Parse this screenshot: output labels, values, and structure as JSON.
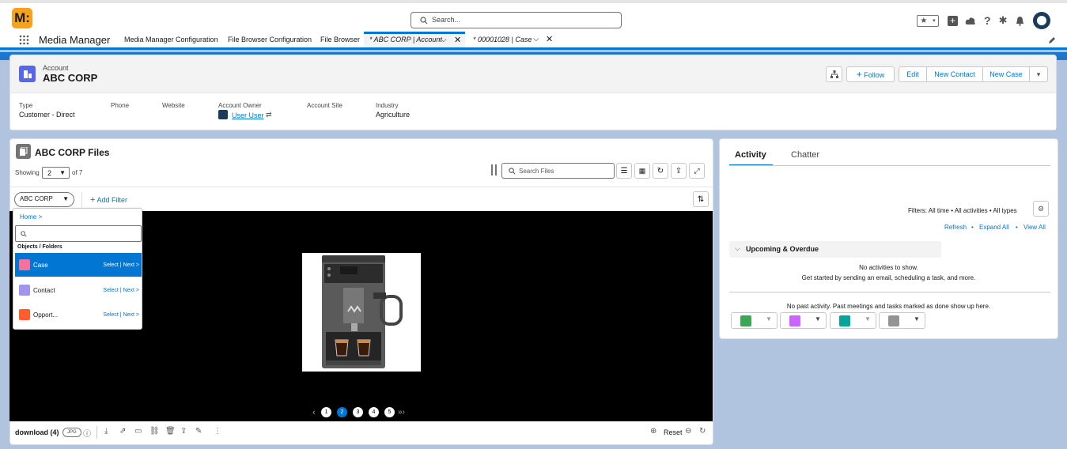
{
  "header": {
    "logo_text": "M:",
    "search_placeholder": "Search...",
    "icons": [
      "favorites-icon",
      "add-icon",
      "cloud-icon",
      "help-icon",
      "settings-icon",
      "bell-icon",
      "avatar"
    ]
  },
  "nav": {
    "app_name": "Media Manager",
    "items": [
      "Media Manager Configuration",
      "File Browser Configuration",
      "File Browser"
    ],
    "tabs": [
      {
        "label": "* ABC CORP | Account",
        "active": true
      },
      {
        "label": "* 00001028 | Case",
        "active": false
      }
    ]
  },
  "account": {
    "object_label": "Account",
    "name": "ABC CORP",
    "buttons": {
      "follow": "Follow",
      "edit": "Edit",
      "new_contact": "New Contact",
      "new_case": "New Case"
    },
    "fields": {
      "type_label": "Type",
      "type_value": "Customer - Direct",
      "phone_label": "Phone",
      "website_label": "Website",
      "owner_label": "Account Owner",
      "owner_value": "User User",
      "site_label": "Account Site",
      "industry_label": "Industry",
      "industry_value": "Agriculture"
    }
  },
  "files": {
    "title": "ABC CORP Files",
    "showing_label": "Showing",
    "showing_value": "2",
    "of_label": "of 7",
    "search_placeholder": "Search Files",
    "filter_value": "ABC CORP",
    "add_filter": "Add Filter",
    "pages": [
      "1",
      "2",
      "3",
      "4",
      "5"
    ],
    "current_page": "2",
    "file_name": "download (4)",
    "file_type": "JPG",
    "reset_label": "Reset"
  },
  "dropdown": {
    "breadcrumb": "Home >",
    "section_label": "Objects / Folders",
    "actions": "Select | Next >",
    "items": [
      {
        "label": "Case",
        "color": "#f56fa3"
      },
      {
        "label": "Contact",
        "color": "#a094ed"
      },
      {
        "label": "Opport...",
        "color": "#ff5d2d"
      }
    ]
  },
  "activity": {
    "tabs": [
      "Activity",
      "Chatter"
    ],
    "filters_text": "Filters: All time • All activities • All types",
    "links": [
      "Refresh",
      "Expand All",
      "View All"
    ],
    "upcoming_label": "Upcoming & Overdue",
    "no_activities": "No activities to show.",
    "get_started": "Get started by sending an email, scheduling a task, and more.",
    "no_past": "No past activity. Past meetings and tasks marked as done show up here."
  },
  "colors": {
    "brand": "#0176d3",
    "logo": "#f7a21b",
    "account_icon": "#5867e8"
  }
}
